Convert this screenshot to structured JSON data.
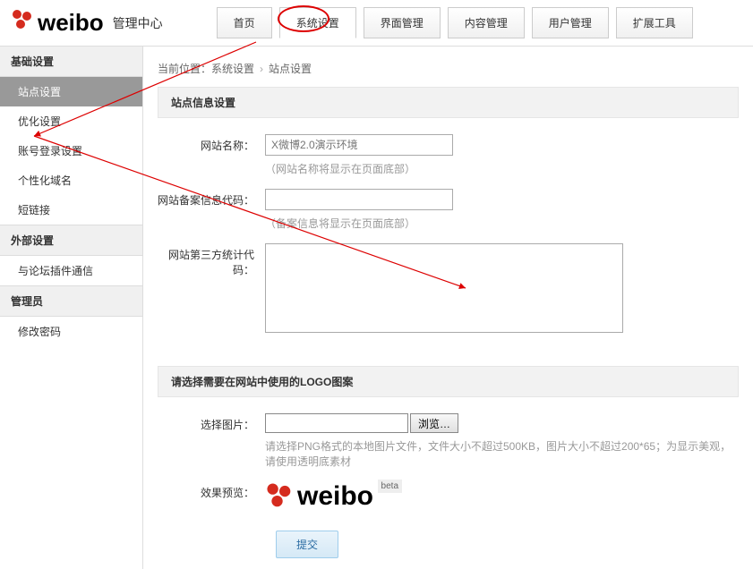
{
  "header": {
    "brand": "weibo",
    "title": "管理中心"
  },
  "nav": [
    {
      "label": "首页",
      "active": false
    },
    {
      "label": "系统设置",
      "active": true
    },
    {
      "label": "界面管理",
      "active": false
    },
    {
      "label": "内容管理",
      "active": false
    },
    {
      "label": "用户管理",
      "active": false
    },
    {
      "label": "扩展工具",
      "active": false
    }
  ],
  "sidebar": {
    "groups": [
      {
        "title": "基础设置",
        "items": [
          {
            "label": "站点设置",
            "active": true
          },
          {
            "label": "优化设置"
          },
          {
            "label": "账号登录设置"
          },
          {
            "label": "个性化域名"
          },
          {
            "label": "短链接"
          }
        ]
      },
      {
        "title": "外部设置",
        "items": [
          {
            "label": "与论坛插件通信"
          }
        ]
      },
      {
        "title": "管理员",
        "items": [
          {
            "label": "修改密码"
          }
        ]
      }
    ]
  },
  "breadcrumb": {
    "prefix": "当前位置：",
    "p1": "系统设置",
    "p2": "站点设置"
  },
  "section1": {
    "title": "站点信息设置",
    "fields": {
      "site_name": {
        "label": "网站名称：",
        "placeholder": "X微博2.0演示环境",
        "hint": "（网站名称将显示在页面底部）"
      },
      "icp": {
        "label": "网站备案信息代码：",
        "hint": "（备案信息将显示在页面底部）"
      },
      "stats": {
        "label": "网站第三方统计代码："
      }
    }
  },
  "section2": {
    "title": "请选择需要在网站中使用的LOGO图案",
    "file": {
      "label": "选择图片：",
      "browse": "浏览…",
      "hint": "请选择PNG格式的本地图片文件，文件大小不超过500KB，图片大小不超过200*65；为显示美观，请使用透明底素材"
    },
    "preview": {
      "label": "效果预览：",
      "brand": "weibo",
      "beta": "beta"
    }
  },
  "submit": "提交"
}
